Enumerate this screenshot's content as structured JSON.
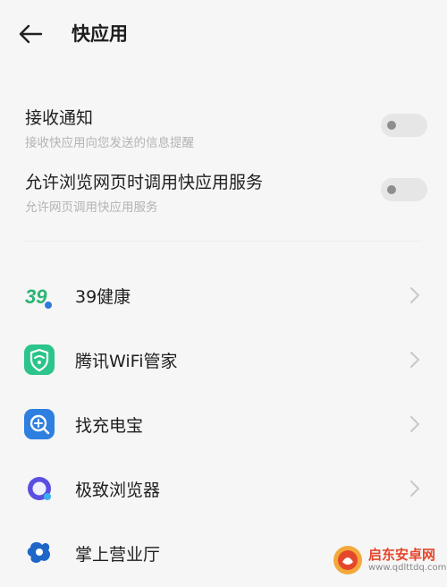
{
  "header": {
    "title": "快应用",
    "back_icon": "arrow-left-icon"
  },
  "settings": [
    {
      "label": "接收通知",
      "desc": "接收快应用向您发送的信息提醒",
      "enabled": false
    },
    {
      "label": "允许浏览网页时调用快应用服务",
      "desc": "允许网页调用快应用服务",
      "enabled": false
    }
  ],
  "apps": [
    {
      "name": "39健康",
      "icon": "39health-icon"
    },
    {
      "name": "腾讯WiFi管家",
      "icon": "wifi-shield-icon"
    },
    {
      "name": "找充电宝",
      "icon": "powerbank-search-icon"
    },
    {
      "name": "极致浏览器",
      "icon": "browser-icon"
    },
    {
      "name": "掌上营业厅",
      "icon": "telecom-icon"
    }
  ],
  "watermark": {
    "title": "启东安卓网",
    "url": "www.qdlttdq.com"
  },
  "colors": {
    "background": "#f6f6f6",
    "toggle_off": "#e6e6e6",
    "brand_green": "#2bc48a",
    "brand_blue": "#2f7bdc"
  }
}
